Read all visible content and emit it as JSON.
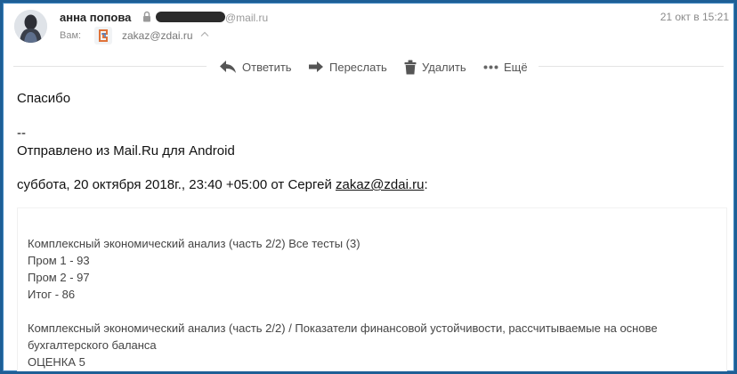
{
  "header": {
    "sender_name": "анна попова",
    "sender_domain": "@mail.ru",
    "date": "21 окт в 15:21",
    "to_label": "Вам:",
    "recipient_email": "zakaz@zdai.ru"
  },
  "toolbar": {
    "reply": "Ответить",
    "forward": "Переслать",
    "delete": "Удалить",
    "more": "Ещё"
  },
  "message": {
    "greeting": "Спасибо",
    "signature_sep": "--",
    "signature": "Отправлено из Mail.Ru для Android",
    "quote_header_prefix": "суббота, 20 октября 2018г., 23:40 +05:00 от Сергей ",
    "quote_header_email": "zakaz@zdai.ru",
    "quote_header_suffix": ":"
  },
  "quoted": {
    "line1": "Комплексный экономический анализ (часть 2/2) Все тесты (3)",
    "line2": "Пром 1 - 93",
    "line3": "Пром 2 - 97",
    "line4": "Итог - 86",
    "line5": "Комплексный экономический анализ (часть 2/2) / Показатели финансовой устойчивости, рассчитываемые на основе",
    "line6": "бухгалтерского баланса",
    "line7": "ОЦЕНКА 5"
  },
  "icons": {
    "lock": "lock-icon",
    "reply": "reply-arrow-icon",
    "forward": "forward-arrow-icon",
    "delete": "trash-icon",
    "more": "more-dots-icon",
    "chevron": "chevron-up-icon"
  },
  "colors": {
    "window_border": "#1e5f96",
    "recipient_logo": "#e0733a"
  }
}
